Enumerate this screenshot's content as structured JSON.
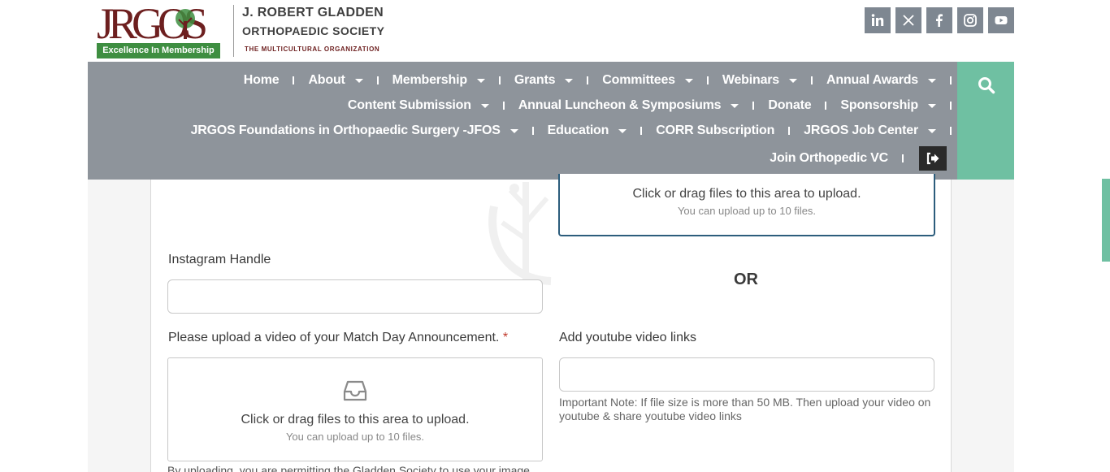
{
  "brand": {
    "logo_letters": "JRGOS",
    "logo_tagline": "Excellence In Membership",
    "name_line1": "J. ROBERT GLADDEN",
    "name_line2": "ORTHOPAEDIC SOCIETY",
    "name_line3": "THE MULTICULTURAL ORGANIZATION",
    "colors": {
      "maroon": "#6d1f1f",
      "green": "#3e8e41",
      "nav_gray": "#8e949b",
      "accent_green": "#6fc0a2"
    }
  },
  "social": [
    {
      "name": "linkedin",
      "label": "in"
    },
    {
      "name": "x-twitter",
      "label": "X"
    },
    {
      "name": "facebook",
      "label": "f"
    },
    {
      "name": "instagram",
      "label": "ig"
    },
    {
      "name": "youtube",
      "label": "yt"
    }
  ],
  "nav": {
    "row1": [
      {
        "label": "Home",
        "dropdown": false
      },
      {
        "label": "About",
        "dropdown": true
      },
      {
        "label": "Membership",
        "dropdown": true
      },
      {
        "label": "Grants",
        "dropdown": true
      },
      {
        "label": "Committees",
        "dropdown": true
      },
      {
        "label": "Webinars",
        "dropdown": true
      },
      {
        "label": "Annual Awards",
        "dropdown": true
      }
    ],
    "row2": [
      {
        "label": "Content Submission",
        "dropdown": true
      },
      {
        "label": "Annual Luncheon & Symposiums",
        "dropdown": true
      },
      {
        "label": "Donate",
        "dropdown": false
      },
      {
        "label": "Sponsorship",
        "dropdown": true
      }
    ],
    "row3": [
      {
        "label": "JRGOS Foundations in Orthopaedic Surgery -JFOS",
        "dropdown": true
      },
      {
        "label": "Education",
        "dropdown": true
      },
      {
        "label": "CORR Subscription",
        "dropdown": false
      },
      {
        "label": "JRGOS Job Center",
        "dropdown": true
      }
    ],
    "row4": [
      {
        "label": "Join Orthopedic VC",
        "dropdown": false
      }
    ]
  },
  "form": {
    "top_upload": {
      "main": "Click or drag files to this area to upload.",
      "sub": "You can upload up to 10 files."
    },
    "instagram_label": "Instagram Handle",
    "instagram_value": "",
    "or_text": "OR",
    "video_label": "Please upload a video of your Match Day Announcement.",
    "required_mark": "*",
    "video_upload": {
      "main": "Click or drag files to this area to upload.",
      "sub": "You can upload up to 10 files."
    },
    "youtube_label": "Add youtube video links",
    "youtube_value": "",
    "youtube_note": "Important Note: If file size is more than 50 MB. Then upload your video on youtube & share youtube video links",
    "consent_text": "By uploading, you are permitting the Gladden Society to use your image"
  }
}
